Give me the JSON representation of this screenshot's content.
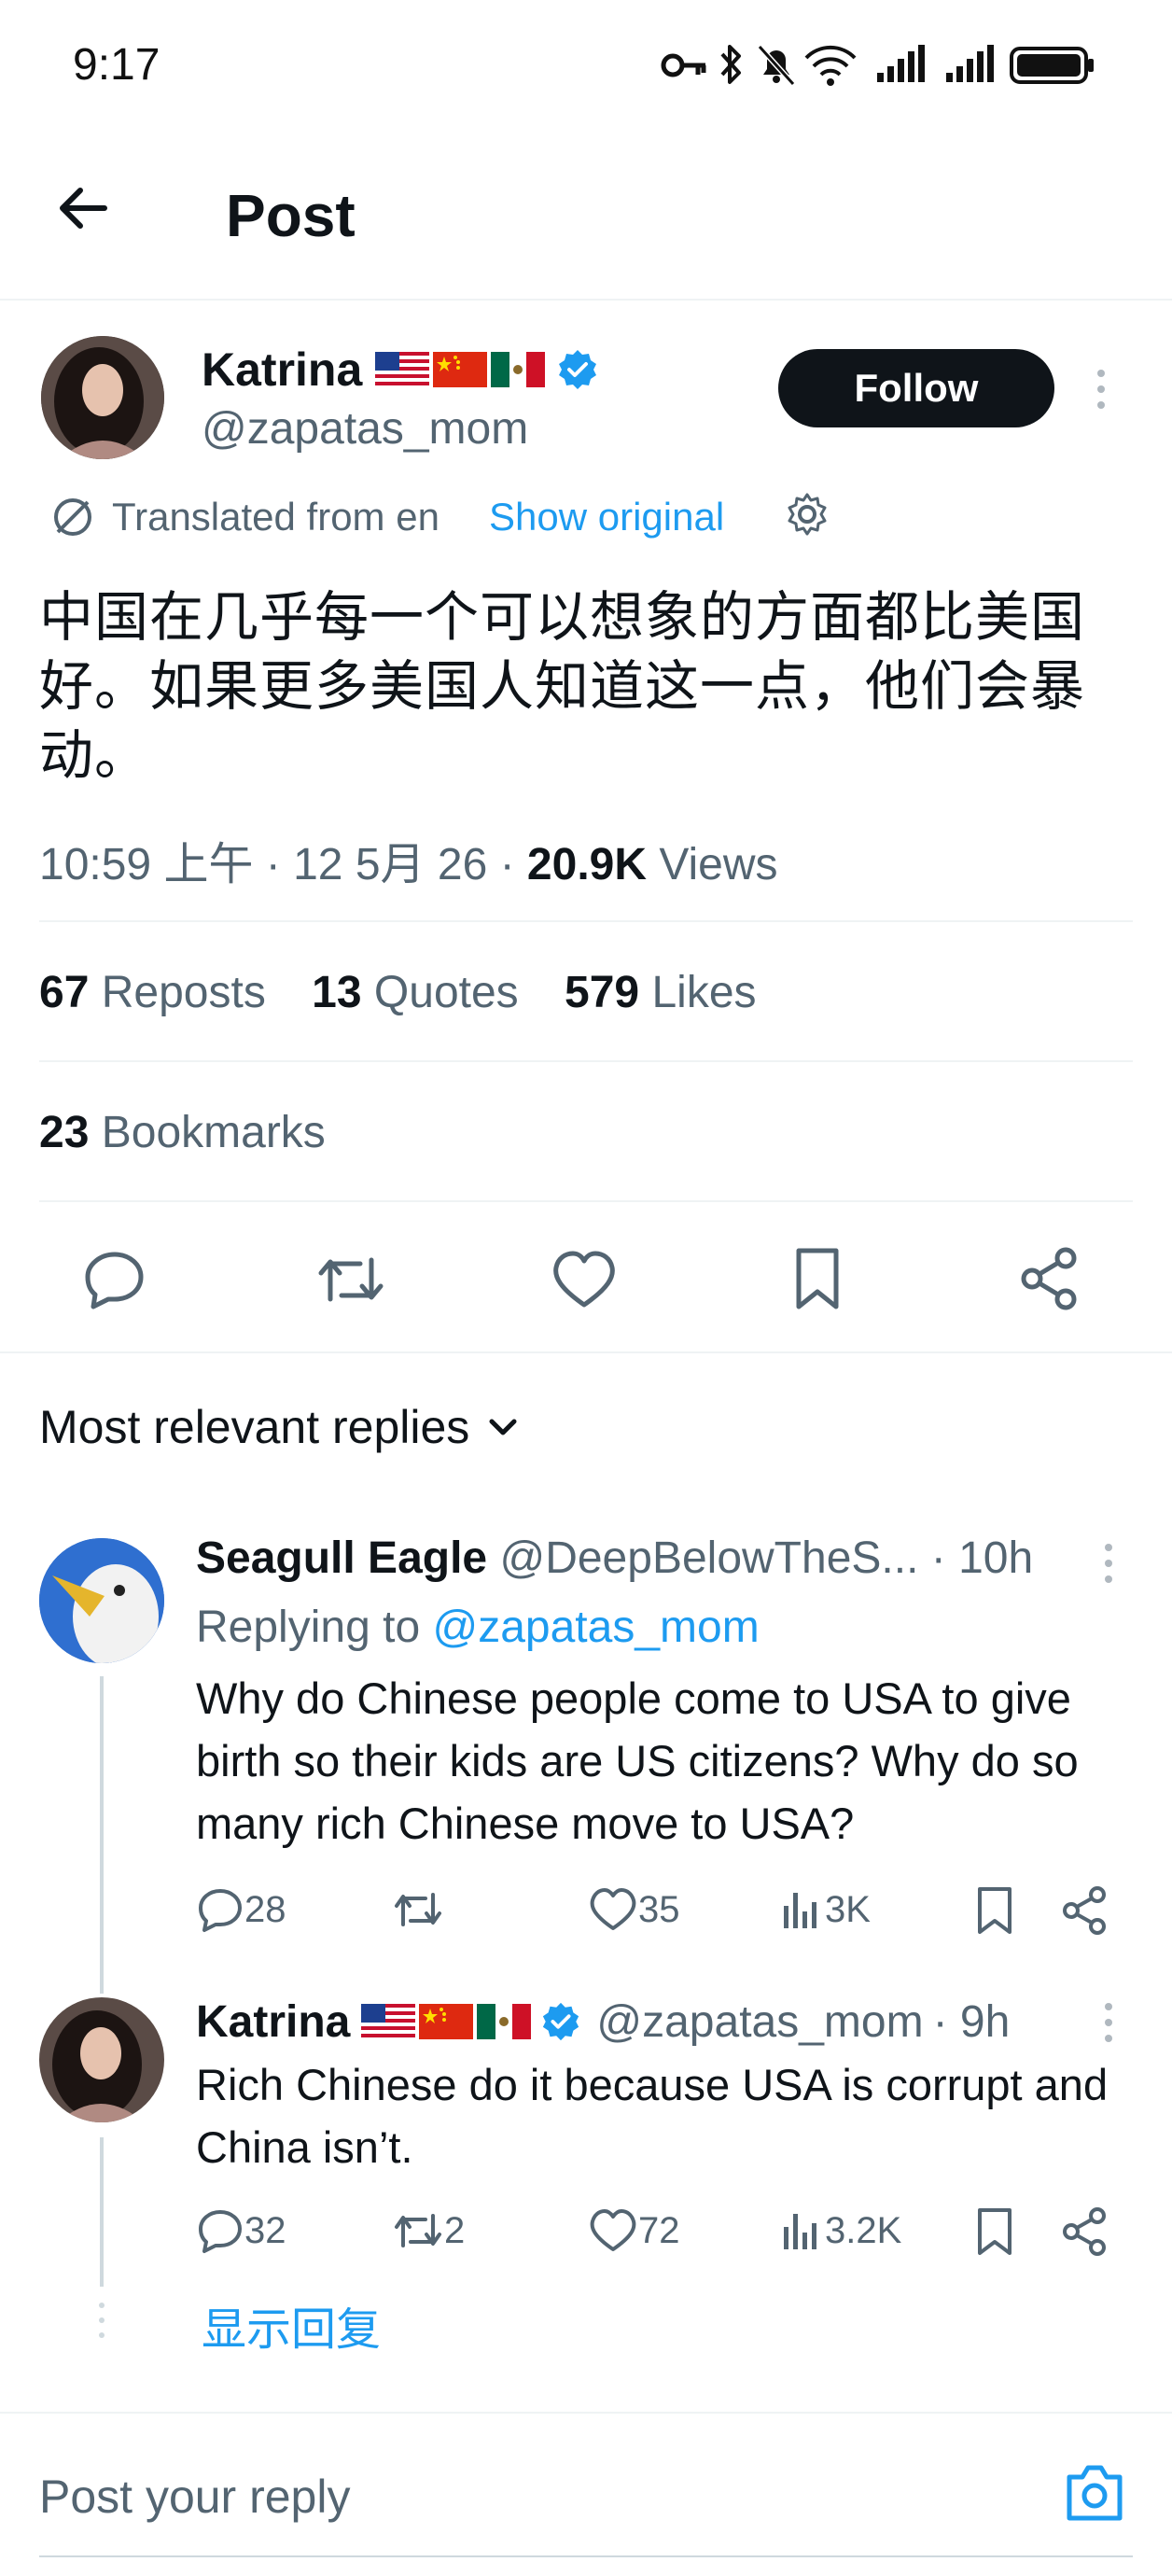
{
  "status_bar": {
    "time": "9:17"
  },
  "header": {
    "title": "Post"
  },
  "tweet": {
    "author_name": "Katrina",
    "author_handle": "@zapatas_mom",
    "follow_label": "Follow",
    "translated_label": "Translated from en",
    "show_original_label": "Show original",
    "text": "中国在几乎每一个可以想象的方面都比美国好。如果更多美国人知道这一点，他们会暴动。",
    "timestamp": "10:59 上午 · 12 5月 26 · ",
    "views_count": "20.9K",
    "views_label": " Views",
    "reposts_count": "67",
    "reposts_label": "Reposts",
    "quotes_count": "13",
    "quotes_label": "Quotes",
    "likes_count": "579",
    "likes_label": "Likes",
    "bookmarks_count": "23",
    "bookmarks_label": "Bookmarks"
  },
  "replies_header": {
    "label": "Most relevant replies"
  },
  "replies": [
    {
      "name": "Seagull Eagle",
      "handle": "@DeepBelowTheS...",
      "time": "· 10h",
      "replying_prefix": "Replying to ",
      "replying_handle": "@zapatas_mom",
      "text": "Why do Chinese people come to USA to give birth so their kids are US citizens? Why do so many rich Chinese move to USA?",
      "comments": "28",
      "reposts": "",
      "likes": "35",
      "views": "3K"
    },
    {
      "name": "Katrina",
      "handle": "@zapatas_mom",
      "time": "· 9h",
      "text": "Rich Chinese do it because USA is corrupt and China isn’t.",
      "comments": "32",
      "reposts": "2",
      "likes": "72",
      "views": "3.2K"
    }
  ],
  "show_replies_label": "显示回复",
  "compose": {
    "placeholder": "Post your reply"
  },
  "colors": {
    "accent": "#1d9bf0",
    "text": "#0f1419",
    "muted": "#536471",
    "divider": "#eff3f4"
  }
}
